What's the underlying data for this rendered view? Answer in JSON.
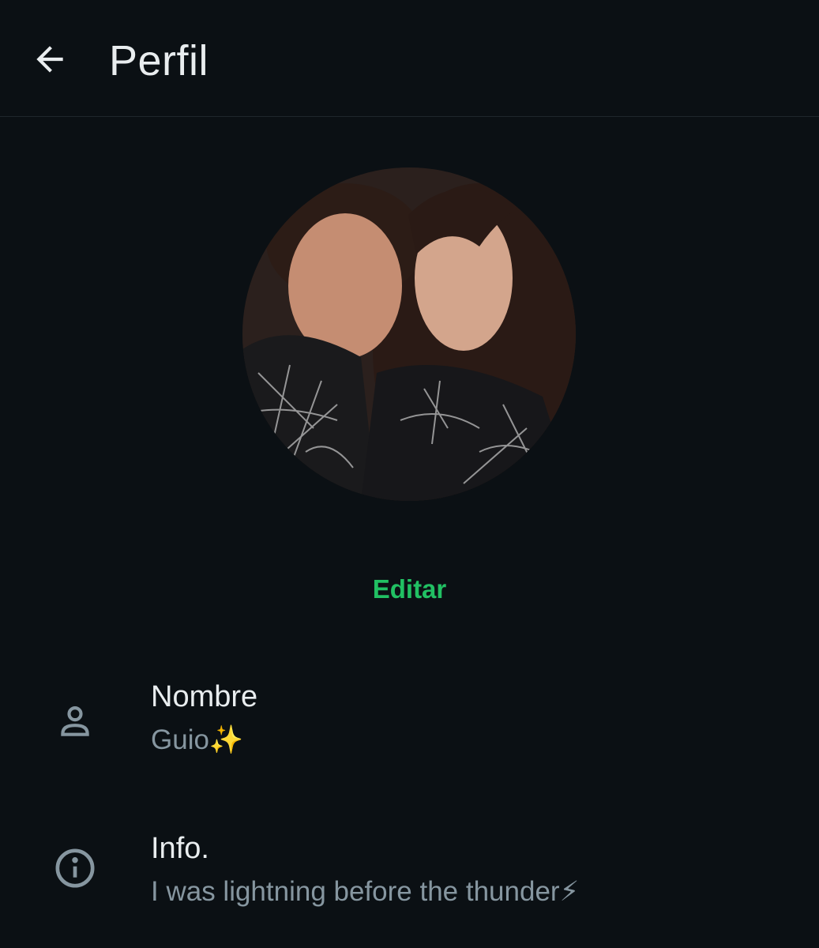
{
  "header": {
    "back_icon": "arrow-left-icon",
    "title": "Perfil"
  },
  "profile": {
    "photo_icon": "profile-photo",
    "edit_label": "Editar"
  },
  "fields": [
    {
      "icon": "person-icon",
      "label": "Nombre",
      "value": "Guio✨"
    },
    {
      "icon": "info-icon",
      "label": "Info.",
      "value": "I was lightning before the thunder⚡"
    }
  ],
  "colors": {
    "background": "#0b1014",
    "accent": "#21c063",
    "primary_text": "#e9edef",
    "secondary_text": "#8696a0"
  }
}
